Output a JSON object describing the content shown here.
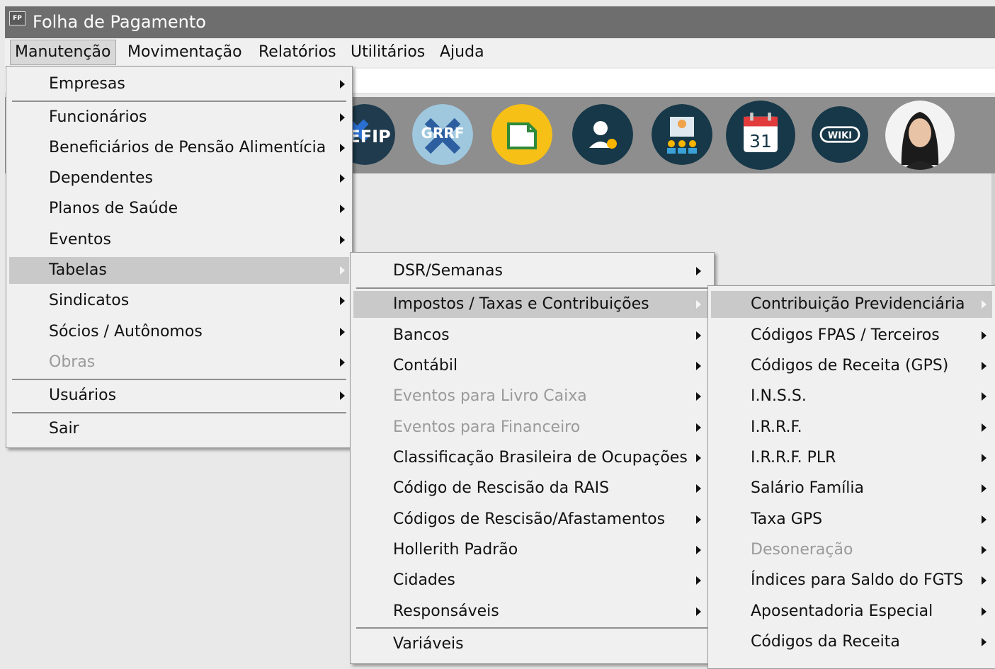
{
  "window": {
    "title": "Folha de Pagamento",
    "icon_text": "FP"
  },
  "menubar": [
    "Manutenção",
    "Movimentação",
    "Relatórios",
    "Utilitários",
    "Ajuda"
  ],
  "toolbar": [
    {
      "name": "sefip-icon",
      "text": "EFIP"
    },
    {
      "name": "grrf-icon",
      "text": "GRRF"
    },
    {
      "name": "document-icon"
    },
    {
      "name": "support-agent-icon"
    },
    {
      "name": "users-group-icon"
    },
    {
      "name": "calendar-icon",
      "text": "31"
    },
    {
      "name": "wiki-icon",
      "text": "WIKI"
    },
    {
      "name": "assistant-avatar-icon"
    }
  ],
  "menu_manutencao": {
    "items": [
      "Empresas",
      "Funcionários",
      "Beneficiários de Pensão Alimentícia",
      "Dependentes",
      "Planos de Saúde",
      "Eventos",
      "Tabelas",
      "Sindicatos",
      "Sócios / Autônomos",
      "Obras",
      "Usuários",
      "Sair"
    ],
    "highlighted": "Tabelas",
    "disabled": [
      "Obras"
    ]
  },
  "menu_tabelas": {
    "items": [
      "DSR/Semanas",
      "Impostos / Taxas e Contribuições",
      "Bancos",
      "Contábil",
      "Eventos para Livro Caixa",
      "Eventos para Financeiro",
      "Classificação Brasileira de Ocupações",
      "Código de Rescisão da RAIS",
      "Códigos de Rescisão/Afastamentos",
      "Hollerith Padrão",
      "Cidades",
      "Responsáveis",
      "Variáveis"
    ],
    "highlighted": "Impostos / Taxas e Contribuições",
    "disabled": [
      "Eventos para Livro Caixa",
      "Eventos para Financeiro"
    ]
  },
  "menu_impostos": {
    "items": [
      "Contribuição Previdenciária",
      "Códigos FPAS / Terceiros",
      "Códigos de Receita (GPS)",
      "I.N.S.S.",
      "I.R.R.F.",
      "I.R.R.F. PLR",
      "Salário Família",
      "Taxa GPS",
      "Desoneração",
      "Índices para Saldo do FGTS",
      "Aposentadoria Especial",
      "Códigos da Receita"
    ],
    "highlighted": "Contribuição Previdenciária",
    "disabled": [
      "Desoneração"
    ]
  }
}
